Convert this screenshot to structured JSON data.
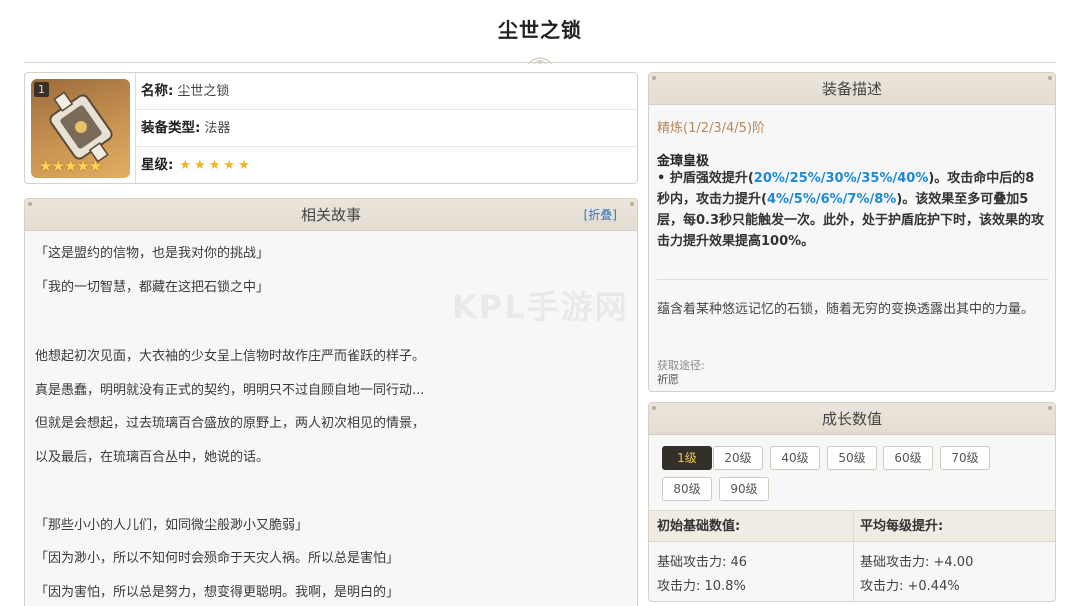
{
  "page": {
    "title": "尘世之锁"
  },
  "watermark": "KPL手游网",
  "card": {
    "refine_badge": "1",
    "name_label": "名称:",
    "name_value": "尘世之锁",
    "type_label": "装备类型:",
    "type_value": "法器",
    "rarity_label": "星级:",
    "rarity_stars": "★★★★★",
    "icon_stars": "★★★★★"
  },
  "story": {
    "title": "相关故事",
    "fold_label": "[折叠]",
    "lines": [
      "「这是盟约的信物，也是我对你的挑战」",
      "「我的一切智慧，都藏在这把石锁之中」",
      "他想起初次见面，大衣袖的少女呈上信物时故作庄严而雀跃的样子。",
      "真是愚蠢，明明就没有正式的契约，明明只不过自顾自地一同行动...",
      "但就是会想起，过去琉璃百合盛放的原野上，两人初次相见的情景，",
      "以及最后，在琉璃百合丛中，她说的话。",
      "「那些小小的人儿们，如同微尘般渺小又脆弱」",
      "「因为渺小，所以不知何时会殒命于天灾人祸。所以总是害怕」",
      "「因为害怕，所以总是努力，想变得更聪明。我啊，是明白的」"
    ]
  },
  "description": {
    "title": "装备描述",
    "refine_text": "精炼(1/2/3/4/5)阶",
    "effect_name": "金璋皇极",
    "effect_parts": {
      "p1": "• 护盾强效提升(",
      "v1": "20%/25%/30%/35%/40%",
      "p2": ")。攻击命中后的8秒内，攻击力提升(",
      "v2": "4%/5%/6%/7%/8%",
      "p3": ")。该效果至多可叠加5层，每0.3秒只能触发一次。此外，处于护盾庇护下时，该效果的攻击力提升效果提高100%。"
    },
    "flavor": "蕴含着某种悠远记忆的石锁，随着无穷的变换透露出其中的力量。",
    "source_label": "获取途径:",
    "source_value": "祈愿"
  },
  "growth": {
    "title": "成长数值",
    "levels": [
      "1级",
      "20级",
      "40级",
      "50级",
      "60级",
      "70级",
      "80级",
      "90级"
    ],
    "active_level": "1级",
    "base_header": "初始基础数值:",
    "avg_header": "平均每级提升:",
    "base_atk": "基础攻击力: 46",
    "base_atk_pct": "攻击力: 10.8%",
    "avg_atk": "基础攻击力: +4.00",
    "avg_atk_pct": "攻击力: +0.44%"
  },
  "colors": {
    "highlight_blue": "#1d8ad6",
    "refine_gold": "#b7895a",
    "active_level_bg": "#33302c",
    "active_level_text": "#f3c24a"
  }
}
